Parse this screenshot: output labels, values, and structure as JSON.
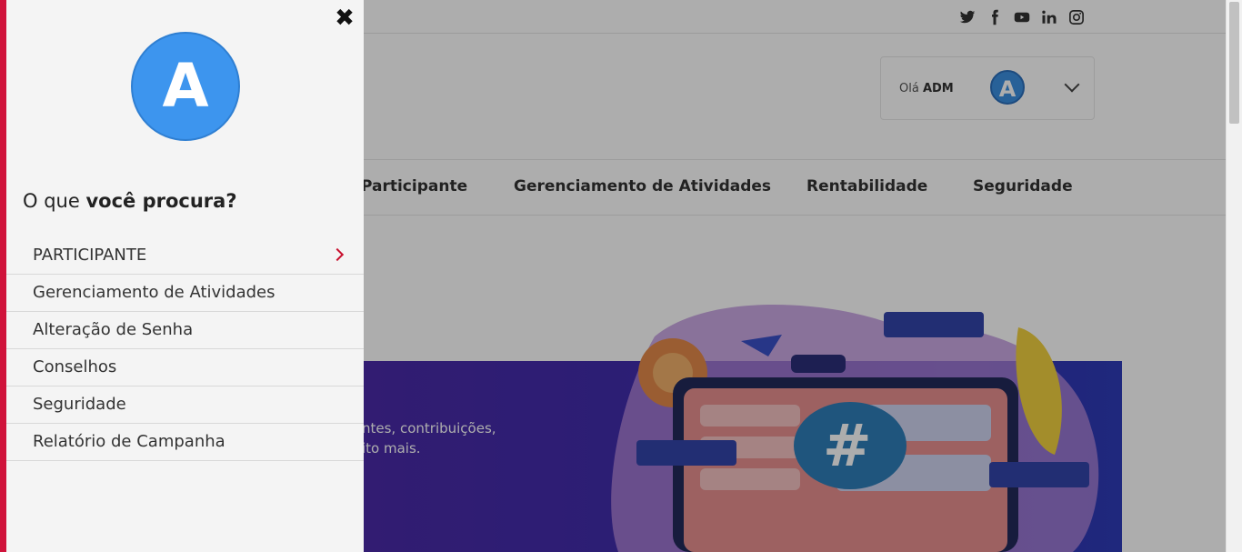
{
  "header": {
    "social_icons": [
      "twitter-icon",
      "facebook-icon",
      "youtube-icon",
      "linkedin-icon",
      "instagram-icon"
    ],
    "greeting": "Olá",
    "user_name": "ADM",
    "avatar_letter": "A"
  },
  "nav": {
    "items": [
      "Participante",
      "Gerenciamento de Atividades",
      "Rentabilidade",
      "Seguridade"
    ]
  },
  "hero": {
    "text_line1": "ntes, contribuições,",
    "text_line2": "ito mais."
  },
  "drawer": {
    "avatar_letter": "A",
    "close_icon": "close-icon",
    "question_prefix": "O que",
    "question_bold": "você procura?",
    "menu": [
      {
        "label": "PARTICIPANTE",
        "has_submenu": true
      },
      {
        "label": "Gerenciamento de Atividades",
        "has_submenu": false
      },
      {
        "label": "Alteração de Senha",
        "has_submenu": false
      },
      {
        "label": "Conselhos",
        "has_submenu": false
      },
      {
        "label": "Seguridade",
        "has_submenu": false
      },
      {
        "label": "Relatório de Campanha",
        "has_submenu": false
      }
    ]
  },
  "colors": {
    "accent": "#d0133b",
    "avatar": "#3d95ee",
    "banner": "#3b2fb0"
  }
}
